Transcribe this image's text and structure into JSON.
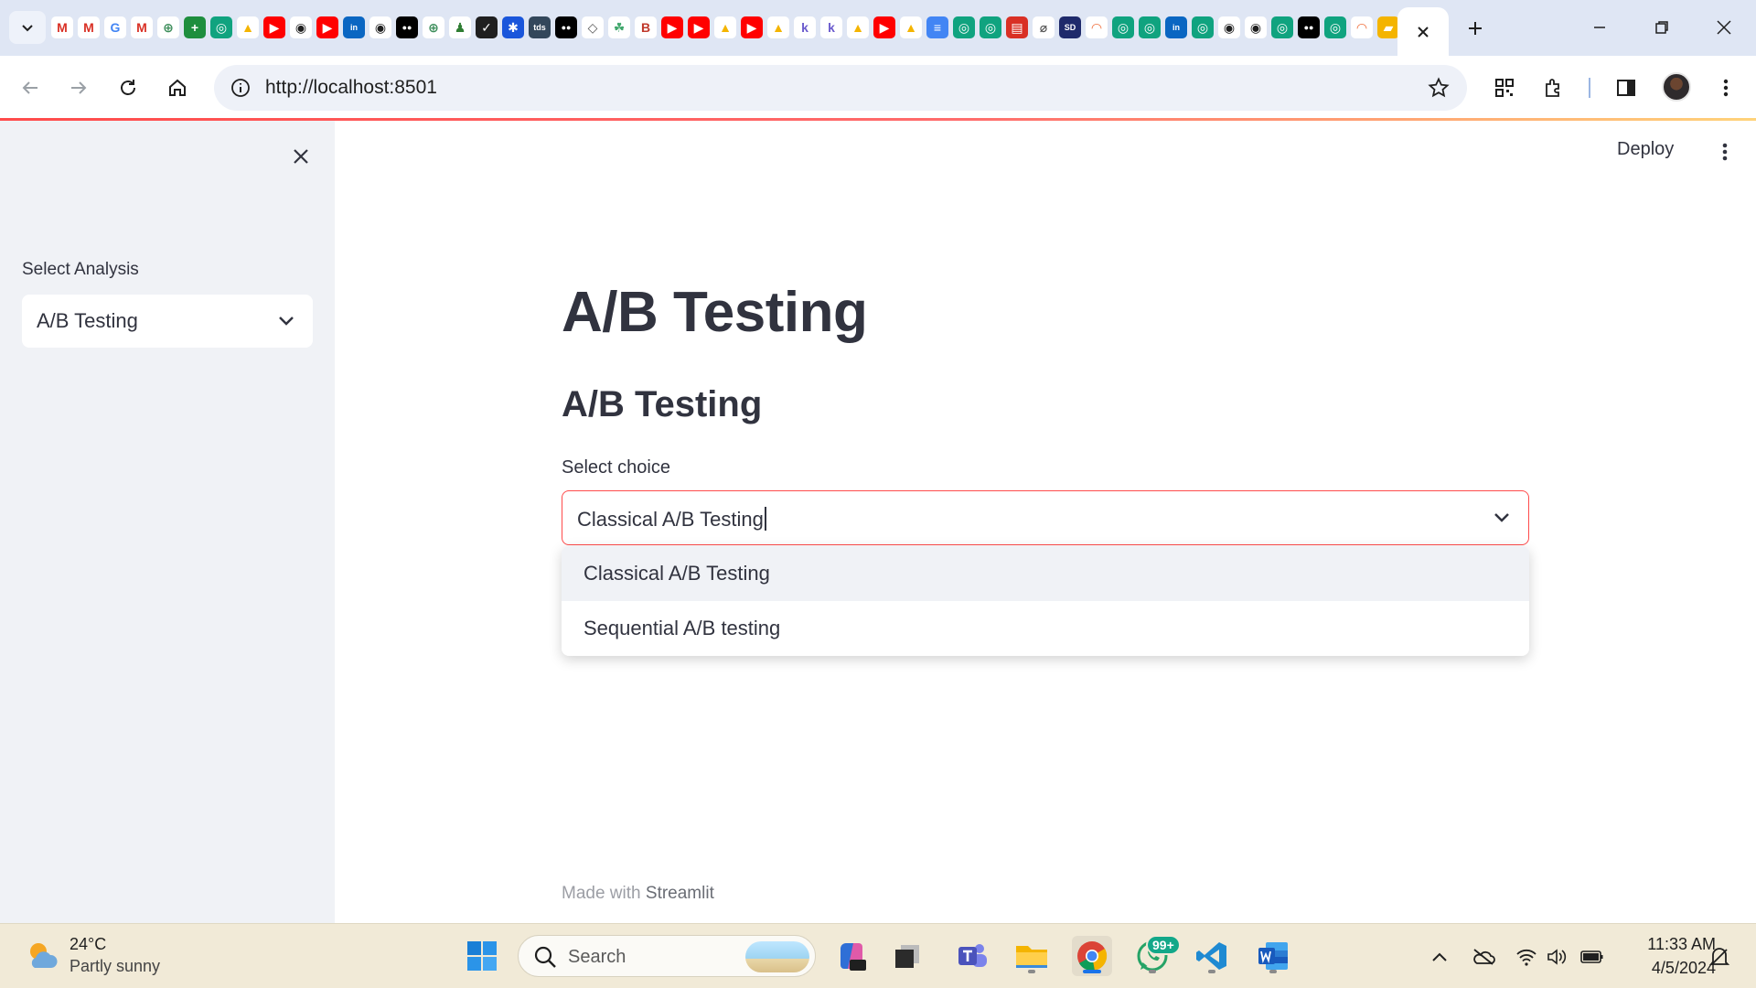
{
  "browser": {
    "url": "http://localhost:8501",
    "favicon_icons": [
      "gmail-icon",
      "gmail-icon",
      "google-icon",
      "gmail-icon",
      "globe-icon",
      "sheets-icon",
      "chatgpt-icon",
      "drive-icon",
      "youtube-icon",
      "github-icon",
      "youtube-icon",
      "linkedin-icon",
      "github-icon",
      "medium-icon",
      "globe-icon",
      "person-icon",
      "v-icon",
      "blue-icon",
      "tds-icon",
      "medium-icon",
      "bookmark-icon",
      "leaf-icon",
      "b-icon",
      "youtube-icon",
      "youtube-icon",
      "drive-icon",
      "youtube-icon",
      "drive-icon",
      "k-icon",
      "k-icon",
      "drive-icon",
      "youtube-icon",
      "drive-icon",
      "docs-icon",
      "chatgpt-icon",
      "chatgpt-icon",
      "pdf-icon",
      "compass-icon",
      "sd-icon",
      "arc-icon",
      "chatgpt-icon",
      "chatgpt-icon",
      "linkedin-icon",
      "chatgpt-icon",
      "github-icon",
      "github-icon",
      "chatgpt-icon",
      "medium-icon",
      "chatgpt-icon",
      "arc-icon",
      "book-icon"
    ]
  },
  "sidebar": {
    "label": "Select Analysis",
    "selected": "A/B Testing"
  },
  "header": {
    "deploy_label": "Deploy"
  },
  "main": {
    "title": "A/B Testing",
    "subheader": "A/B Testing",
    "select_label": "Select choice",
    "select_value": "Classical A/B Testing",
    "options": [
      "Classical A/B Testing",
      "Sequential A/B testing"
    ]
  },
  "footer": {
    "prefix": "Made with",
    "brand": "Streamlit"
  },
  "taskbar": {
    "temperature": "24°C",
    "condition": "Partly sunny",
    "search_placeholder": "Search",
    "whatsapp_badge": "99+",
    "time": "11:33 AM",
    "date": "4/5/2024"
  },
  "colors": {
    "accent": "#ff4b4b",
    "sidebar_bg": "#f0f2f6",
    "text": "#31333f",
    "tabstrip_bg": "#dfe6f4",
    "taskbar_bg": "#f1ead7"
  }
}
